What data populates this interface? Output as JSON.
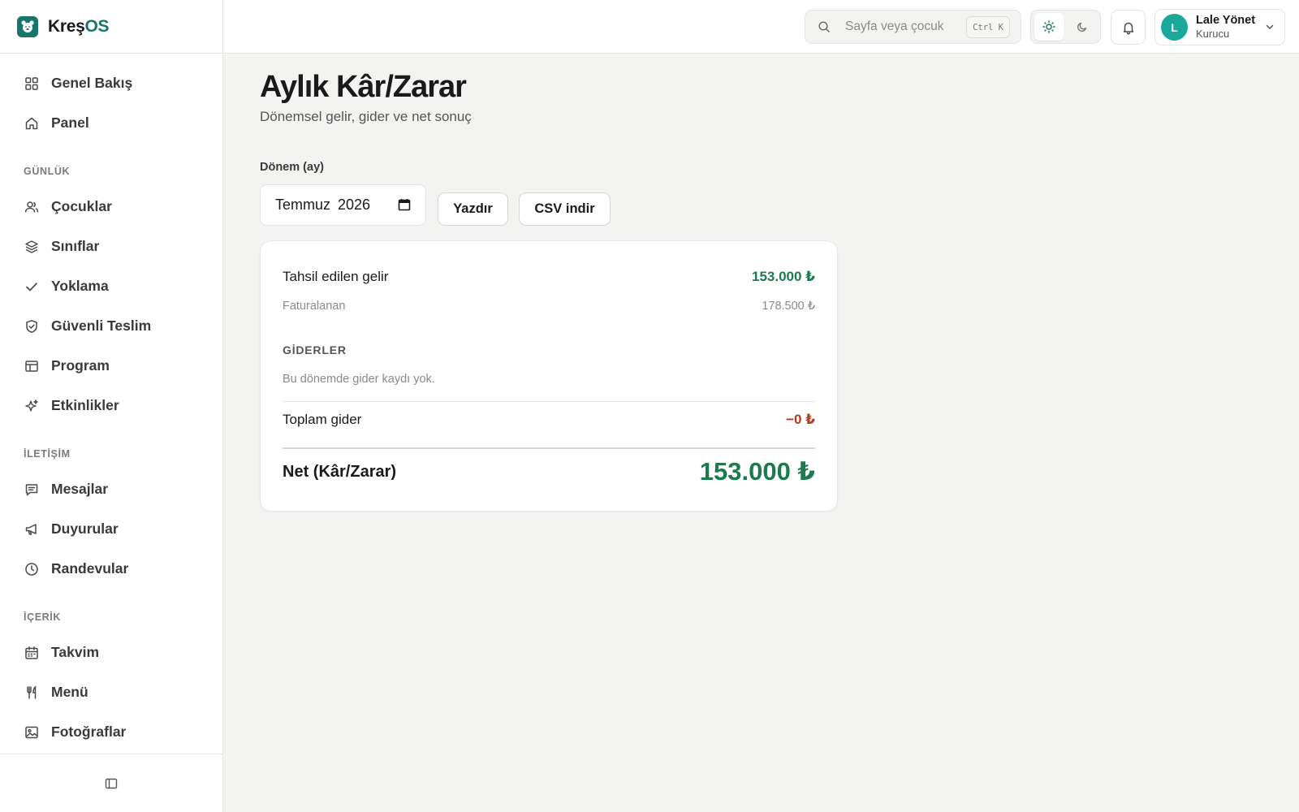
{
  "brand": {
    "name_main": "Kreş",
    "name_accent": "OS"
  },
  "sidebar": {
    "top_items": [
      {
        "label": "Genel Bakış",
        "icon": "grid-icon"
      },
      {
        "label": "Panel",
        "icon": "home-icon"
      }
    ],
    "sections": [
      {
        "title": "GÜNLÜK",
        "items": [
          {
            "label": "Çocuklar",
            "icon": "users-icon"
          },
          {
            "label": "Sınıflar",
            "icon": "layers-icon"
          },
          {
            "label": "Yoklama",
            "icon": "check-icon"
          },
          {
            "label": "Güvenli Teslim",
            "icon": "shield-check-icon"
          },
          {
            "label": "Program",
            "icon": "table-icon"
          },
          {
            "label": "Etkinlikler",
            "icon": "sparkles-icon"
          }
        ]
      },
      {
        "title": "İLETİŞİM",
        "items": [
          {
            "label": "Mesajlar",
            "icon": "message-icon"
          },
          {
            "label": "Duyurular",
            "icon": "megaphone-icon"
          },
          {
            "label": "Randevular",
            "icon": "clock-icon"
          }
        ]
      },
      {
        "title": "İÇERİK",
        "items": [
          {
            "label": "Takvim",
            "icon": "calendar-icon"
          },
          {
            "label": "Menü",
            "icon": "utensils-icon"
          },
          {
            "label": "Fotoğraflar",
            "icon": "image-icon"
          }
        ]
      }
    ]
  },
  "header": {
    "search_placeholder": "Sayfa veya çocuk",
    "search_shortcut": "Ctrl K",
    "user": {
      "initial": "L",
      "name": "Lale Yönet",
      "role": "Kurucu"
    }
  },
  "page": {
    "title": "Aylık Kâr/Zarar",
    "subtitle": "Dönemsel gelir, gider ve net sonuç",
    "period_label": "Dönem (ay)",
    "period_value": "Temmuz 2026",
    "print_label": "Yazdır",
    "csv_label": "CSV indir"
  },
  "report": {
    "income_label": "Tahsil edilen gelir",
    "income_value": "153.000 ₺",
    "billed_label": "Faturalanan",
    "billed_value": "178.500 ₺",
    "expenses_heading": "GİDERLER",
    "expenses_empty": "Bu dönemde gider kaydı yok.",
    "total_expense_label": "Toplam gider",
    "total_expense_value": "−0 ₺",
    "net_label": "Net (Kâr/Zarar)",
    "net_value": "153.000 ₺"
  },
  "colors": {
    "brand": "#17756a",
    "positive": "#1d7a4f",
    "negative": "#b23a1f",
    "avatar": "#1aa89a"
  }
}
